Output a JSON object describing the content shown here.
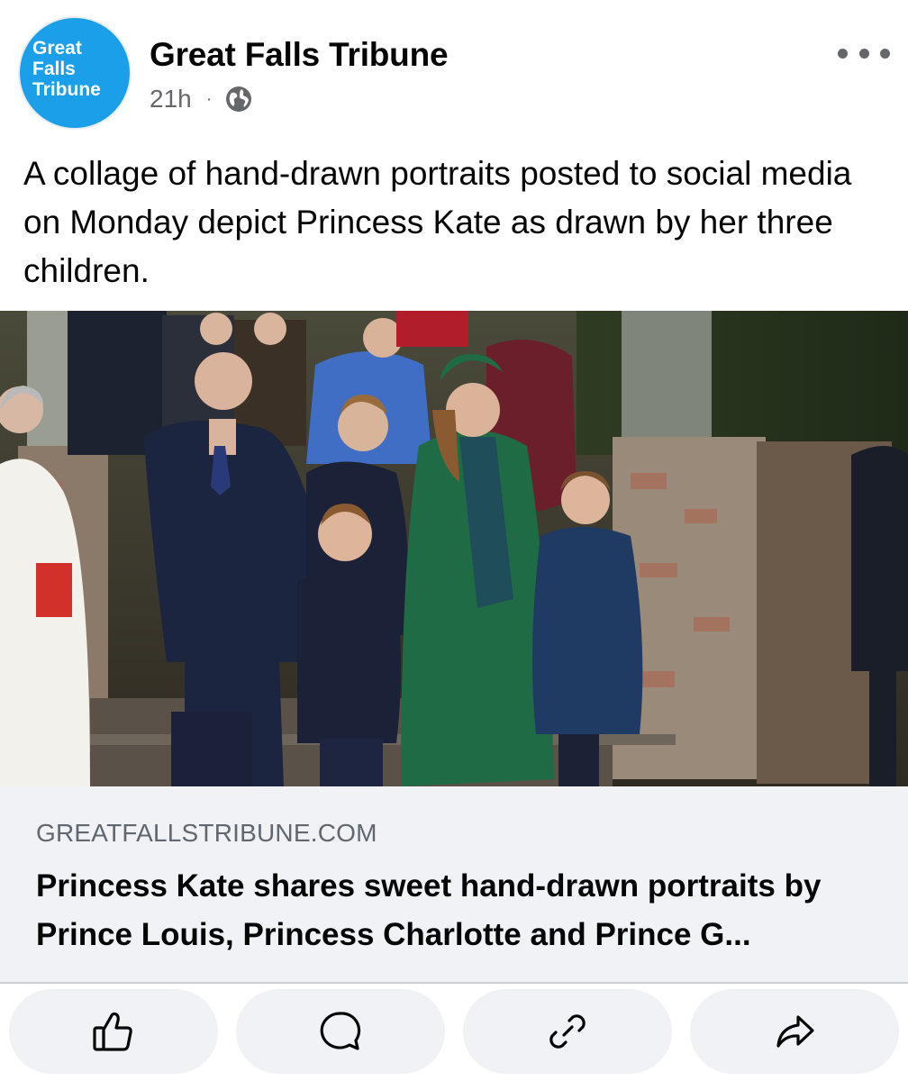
{
  "post": {
    "page": {
      "avatar_text": "Great\nFalls\nTribune",
      "name": "Great Falls Tribune",
      "time": "21h",
      "separator": "·",
      "audience_icon": "globe-icon"
    },
    "more_icon": "more-dots-icon",
    "caption": "A collage of hand-drawn portraits posted to social media on Monday depict Princess Kate as drawn by her three children."
  },
  "link_preview": {
    "domain": "GREATFALLSTRIBUNE.COM",
    "title": "Princess Kate shares sweet hand-drawn portraits by Prince Louis, Princess Charlotte and Prince G..."
  },
  "actions": [
    {
      "icon": "thumbs-up-icon"
    },
    {
      "icon": "comment-icon"
    },
    {
      "icon": "link-icon"
    },
    {
      "icon": "share-icon"
    }
  ],
  "colors": {
    "brand_blue": "#1a9fe8",
    "secondary_text": "#65676b",
    "link_box_bg": "#f0f2f5",
    "coat_green": "#1f6b45"
  }
}
